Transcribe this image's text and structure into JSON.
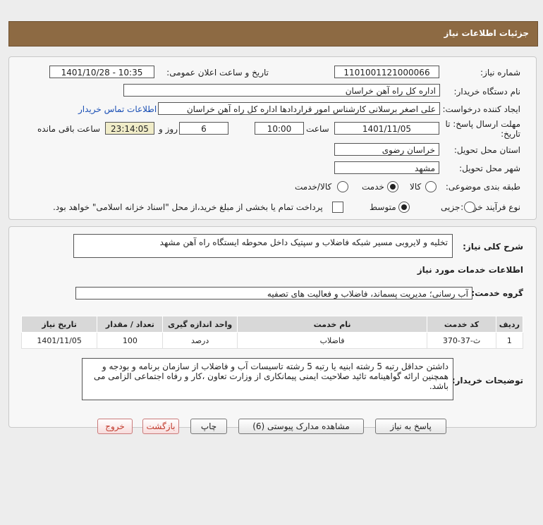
{
  "page_title": "جزئیات اطلاعات نیاز",
  "need_number": {
    "label": "شماره نیاز:",
    "value": "1101001121000066"
  },
  "announce_datetime": {
    "label": "تاریخ و ساعت اعلان عمومی:",
    "value": "1401/10/28 - 10:35"
  },
  "buyer_org": {
    "label": "نام دستگاه خریدار:",
    "value": "اداره کل راه آهن خراسان"
  },
  "requester": {
    "label": "ایجاد کننده درخواست:",
    "value": "علی اصغر برسلانی کارشناس امور قراردادها اداره کل راه آهن خراسان",
    "contact_link": "اطلاعات تماس خریدار"
  },
  "deadline": {
    "label_line1": "مهلت ارسال پاسخ: تا",
    "label_line2": "تاریخ:",
    "date": "1401/11/05",
    "time_label": "ساعت",
    "time": "10:00",
    "days": "6",
    "days_label": "روز و",
    "remaining": "23:14:05",
    "remaining_label": "ساعت باقی مانده"
  },
  "delivery_province": {
    "label": "استان محل تحویل:",
    "value": "خراسان رضوی"
  },
  "delivery_city": {
    "label": "شهر محل تحویل:",
    "value": "مشهد"
  },
  "subject_category": {
    "label": "طبقه بندی موضوعی:",
    "options": [
      "کالا",
      "خدمت",
      "کالا/خدمت"
    ],
    "selected": "خدمت"
  },
  "purchase_type": {
    "label": "نوع فرآیند خرید :",
    "options": [
      "جزیی",
      "متوسط"
    ],
    "selected": "متوسط",
    "treasury_note": "پرداخت تمام یا بخشی از مبلغ خرید،از محل \"اسناد خزانه اسلامی\" خواهد بود."
  },
  "summary": {
    "label": "شرح کلی نیاز:",
    "value": "تخلیه و لایروبی مسیر شبکه فاضلاب و سپتیک داخل محوطه ایستگاه راه آهن مشهد"
  },
  "services_title": "اطلاعات خدمات مورد نیاز",
  "service_group": {
    "label": "گروه خدمت:",
    "value": "آب رسانی؛ مدیریت پسماند، فاضلاب و فعالیت های تصفیه"
  },
  "table": {
    "headers": [
      "ردیف",
      "کد خدمت",
      "نام خدمت",
      "واحد اندازه گیری",
      "تعداد / مقدار",
      "تاریخ نیاز"
    ],
    "rows": [
      [
        "1",
        "ث-37-370",
        "فاضلاب",
        "درصد",
        "100",
        "1401/11/05"
      ]
    ]
  },
  "buyer_notes": {
    "label": "توضیحات خریدار:",
    "value": "داشتن حداقل رتبه 5 رشته ابنیه یا رتبه 5 رشته تاسیسات آب و فاضلاب از سازمان برنامه و بودجه و همچنین ارائه گواهینامه تائید صلاحیت ایمنی پیمانکاری از وزارت تعاون ،کار و رفاه اجتماعی الزامی می باشد."
  },
  "buttons": {
    "respond": "پاسخ به نیاز",
    "attachments": "مشاهده مدارک پیوستی (6)",
    "print": "چاپ",
    "back": "بازگشت",
    "exit": "خروج"
  },
  "colors": {
    "header_bg": "#8d6a43",
    "link": "#1a4fb5",
    "exit_text": "#c0392b"
  }
}
